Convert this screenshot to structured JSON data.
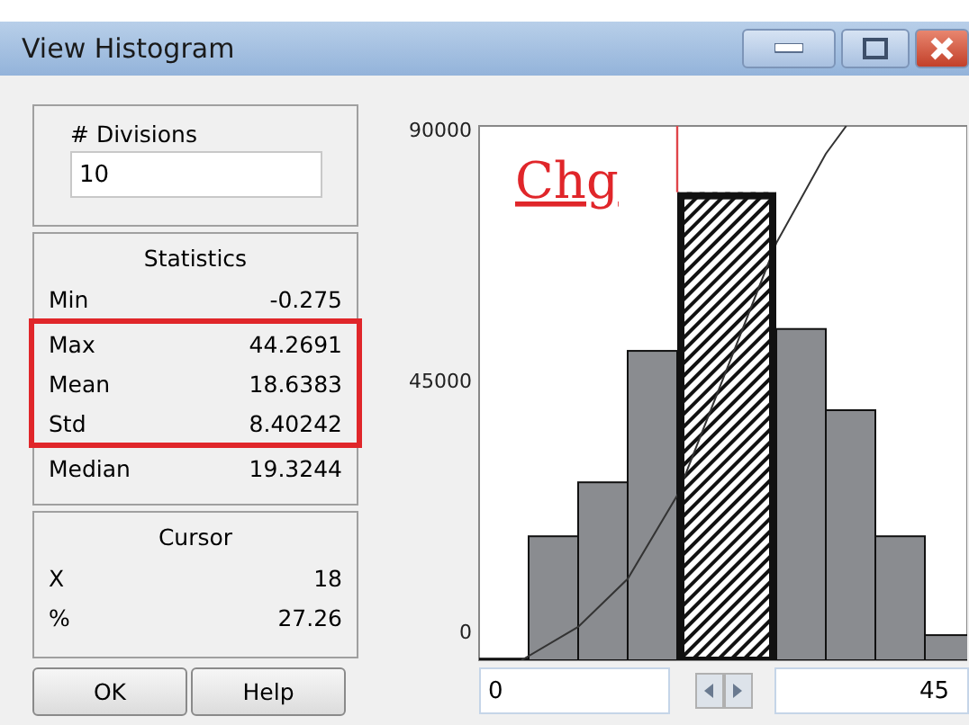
{
  "window": {
    "title": "View Histogram"
  },
  "divisions": {
    "label": "# Divisions",
    "value": "10"
  },
  "statistics": {
    "title": "Statistics",
    "rows": [
      {
        "label": "Min",
        "value": "-0.275",
        "highlighted": false
      },
      {
        "label": "Max",
        "value": "44.2691",
        "highlighted": true
      },
      {
        "label": "Mean",
        "value": "18.6383",
        "highlighted": true
      },
      {
        "label": "Std",
        "value": "8.40242",
        "highlighted": true
      },
      {
        "label": "Median",
        "value": "19.3244",
        "highlighted": false
      }
    ]
  },
  "cursor": {
    "title": "Cursor",
    "rows": [
      {
        "label": "X",
        "value": "18"
      },
      {
        "label": "%",
        "value": "27.26"
      }
    ]
  },
  "buttons": [
    "OK",
    "Help"
  ],
  "chart": {
    "overlay_label": "Chg",
    "y_axis_labels": [
      "90000",
      "45000",
      "0"
    ],
    "range_min": "0",
    "range_max": "45",
    "bins": [
      {
        "selected": false
      },
      {
        "selected": false
      },
      {
        "selected": false
      },
      {
        "selected": false
      },
      {
        "selected": true
      },
      {
        "selected": true
      },
      {
        "selected": false
      },
      {
        "selected": false
      },
      {
        "selected": false
      },
      {
        "selected": false
      }
    ]
  }
}
